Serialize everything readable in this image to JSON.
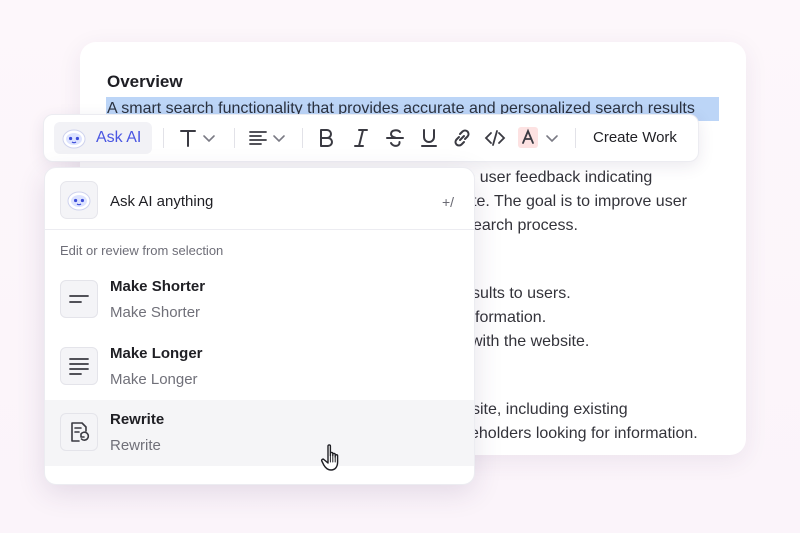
{
  "document": {
    "title": "Overview",
    "highlighted_text": "A smart search functionality that provides accurate and personalized search results",
    "visible_lines": [
      "m user feedback indicating",
      "te. The goal is to improve user",
      "earch process.",
      "sults to users.",
      "formation.",
      "with the website.",
      "site, including existing",
      "eholders looking for information."
    ]
  },
  "toolbar": {
    "ask_ai_label": "Ask AI",
    "create_work_label": "Create Work",
    "icons": [
      "ai-bot-icon",
      "text-type-icon",
      "chevron-down-icon",
      "align-icon",
      "chevron-down-icon",
      "bold-icon",
      "italic-icon",
      "strikethrough-icon",
      "underline-icon",
      "link-icon",
      "code-icon",
      "text-color-icon",
      "chevron-down-icon"
    ],
    "accent_color": "#4a56e2",
    "text_color_swatch": "#fde2e2"
  },
  "menu": {
    "ask_anything_label": "Ask AI anything",
    "shortcut": "+/",
    "section_label": "Edit or review from selection",
    "items": [
      {
        "title": "Make Shorter",
        "subtitle": "Make Shorter",
        "icon": "short-lines-icon"
      },
      {
        "title": "Make Longer",
        "subtitle": "Make Longer",
        "icon": "long-lines-icon"
      },
      {
        "title": "Rewrite",
        "subtitle": "Rewrite",
        "icon": "rewrite-icon"
      }
    ],
    "hovered_item": "Rewrite"
  },
  "highlight_color": "#bcd5f7"
}
